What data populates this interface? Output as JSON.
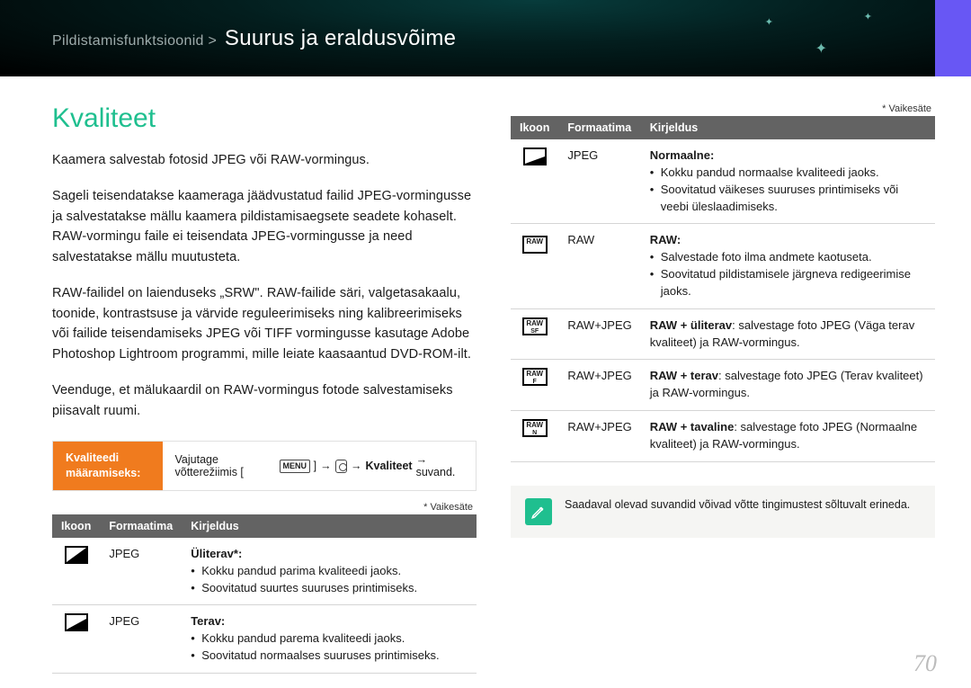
{
  "header": {
    "section": "Pildistamisfunktsioonid >",
    "title": "Suurus ja eraldusvõime"
  },
  "heading": "Kvaliteet",
  "paragraphs": [
    "Kaamera salvestab fotosid JPEG või RAW-vormingus.",
    "Sageli teisendatakse kaameraga jäädvustatud failid JPEG-vormingusse ja salvestatakse mällu kaamera pildistamisaegsete seadete kohaselt. RAW-vormingu faile ei teisendata JPEG-vormingusse ja need salvestatakse mällu muutusteta.",
    "RAW-failidel on laienduseks „SRW\". RAW-failide säri, valgetasakaalu, toonide, kontrastsuse ja värvide reguleerimiseks ning kalibreerimiseks või failide teisendamiseks JPEG või TIFF vormingusse kasutage Adobe Photoshop Lightroom programmi, mille leiate kaasaantud DVD-ROM-ilt.",
    "Veenduge, et mälukaardil on RAW-vormingus fotode salvestamiseks piisavalt ruumi."
  ],
  "setbox": {
    "label": "Kvaliteedi määramiseks:",
    "instr_pre": "Vajutage võtterežiimis [",
    "menu": "MENU",
    "arrow": "→",
    "kval": "Kvaliteet",
    "instr_post": "→ suvand."
  },
  "default_note": "* Vaikesäte",
  "table_headers": {
    "icon": "Ikoon",
    "format": "Formaatima",
    "desc": "Kirjeldus"
  },
  "left_rows": [
    {
      "format": "JPEG",
      "title": "Üliterav*:",
      "bullets": [
        "Kokku pandud parima kvaliteedi jaoks.",
        "Soovitatud suurtes suuruses printimiseks."
      ]
    },
    {
      "format": "JPEG",
      "title": "Terav:",
      "bullets": [
        "Kokku pandud parema kvaliteedi jaoks.",
        "Soovitatud normaalses suuruses printimiseks."
      ]
    }
  ],
  "right_rows": [
    {
      "format": "JPEG",
      "title": "Normaalne:",
      "bullets": [
        "Kokku pandud normaalse kvaliteedi jaoks.",
        "Soovitatud väikeses suuruses printimiseks või veebi üleslaadimiseks."
      ]
    },
    {
      "format": "RAW",
      "title": "RAW:",
      "bullets": [
        "Salvestade foto ilma andmete kaotuseta.",
        "Soovitatud pildistamisele järgneva redigeerimise jaoks."
      ]
    },
    {
      "format": "RAW+JPEG",
      "line_strong": "RAW + üliterav",
      "line_rest": ": salvestage foto JPEG (Väga terav kvaliteet) ja RAW-vormingus."
    },
    {
      "format": "RAW+JPEG",
      "line_strong": "RAW + terav",
      "line_rest": ": salvestage foto JPEG (Terav kvaliteet) ja RAW-vormingus."
    },
    {
      "format": "RAW+JPEG",
      "line_strong": "RAW + tavaline",
      "line_rest": ": salvestage foto JPEG (Normaalne kvaliteet) ja RAW-vormingus."
    }
  ],
  "note": "Saadaval olevad suvandid võivad võtte tingimustest sõltuvalt erineda.",
  "page_number": "70"
}
